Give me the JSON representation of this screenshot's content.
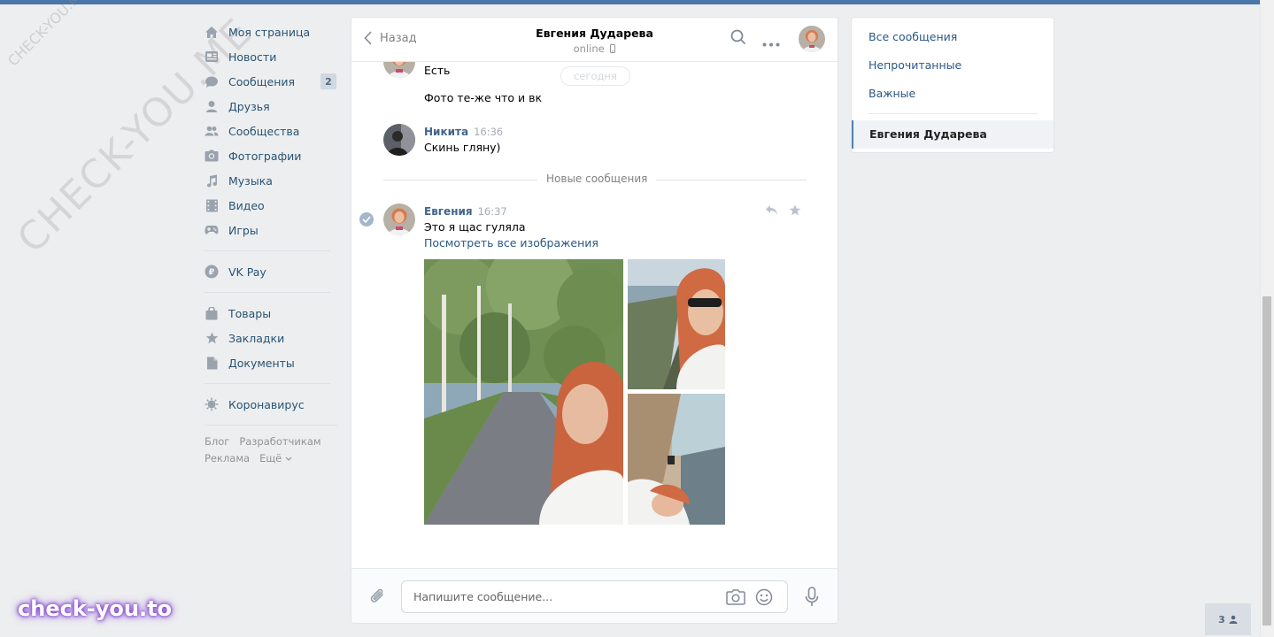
{
  "watermarks": {
    "small": "CHECK-YOU.ME",
    "large": "CHECK-YOU.ME",
    "logo": "check-you.to"
  },
  "nav": {
    "items": [
      {
        "label": "Моя страница",
        "icon": "home-icon"
      },
      {
        "label": "Новости",
        "icon": "news-icon"
      },
      {
        "label": "Сообщения",
        "icon": "messages-icon",
        "badge": "2"
      },
      {
        "label": "Друзья",
        "icon": "friends-icon"
      },
      {
        "label": "Сообщества",
        "icon": "communities-icon"
      },
      {
        "label": "Фотографии",
        "icon": "camera-icon"
      },
      {
        "label": "Музыка",
        "icon": "music-icon"
      },
      {
        "label": "Видео",
        "icon": "video-icon"
      },
      {
        "label": "Игры",
        "icon": "gamepad-icon"
      }
    ],
    "vkpay": "VK Pay",
    "items2": [
      {
        "label": "Товары",
        "icon": "bag-icon"
      },
      {
        "label": "Закладки",
        "icon": "star-icon"
      },
      {
        "label": "Документы",
        "icon": "document-icon"
      }
    ],
    "corona": "Коронавирус",
    "footer": [
      "Блог",
      "Разработчикам",
      "Реклама",
      "Ещё"
    ]
  },
  "chat": {
    "back_label": "Назад",
    "peer_name": "Евгения Дударева",
    "peer_status": "online",
    "date_pill": "сегодня",
    "messages": [
      {
        "text": "Есть"
      },
      {
        "text": "Фото те-же что и вк"
      },
      {
        "author": "Никита",
        "time": "16:36",
        "text": "Скинь гляну)"
      }
    ],
    "new_messages_label": "Новые сообщения",
    "last_message": {
      "author": "Евгения",
      "time": "16:37",
      "text": "Это я щас гуляла",
      "link": "Посмотреть все изображения"
    },
    "composer_placeholder": "Напишите сообщение..."
  },
  "filters": {
    "items": [
      "Все сообщения",
      "Непрочитанные",
      "Важные"
    ],
    "active": "Евгения Дударева"
  },
  "online_count": "3",
  "colors": {
    "accent": "#4a76a8",
    "link": "#2a5885",
    "nav_text": "#285473",
    "background": "#edeef0"
  }
}
